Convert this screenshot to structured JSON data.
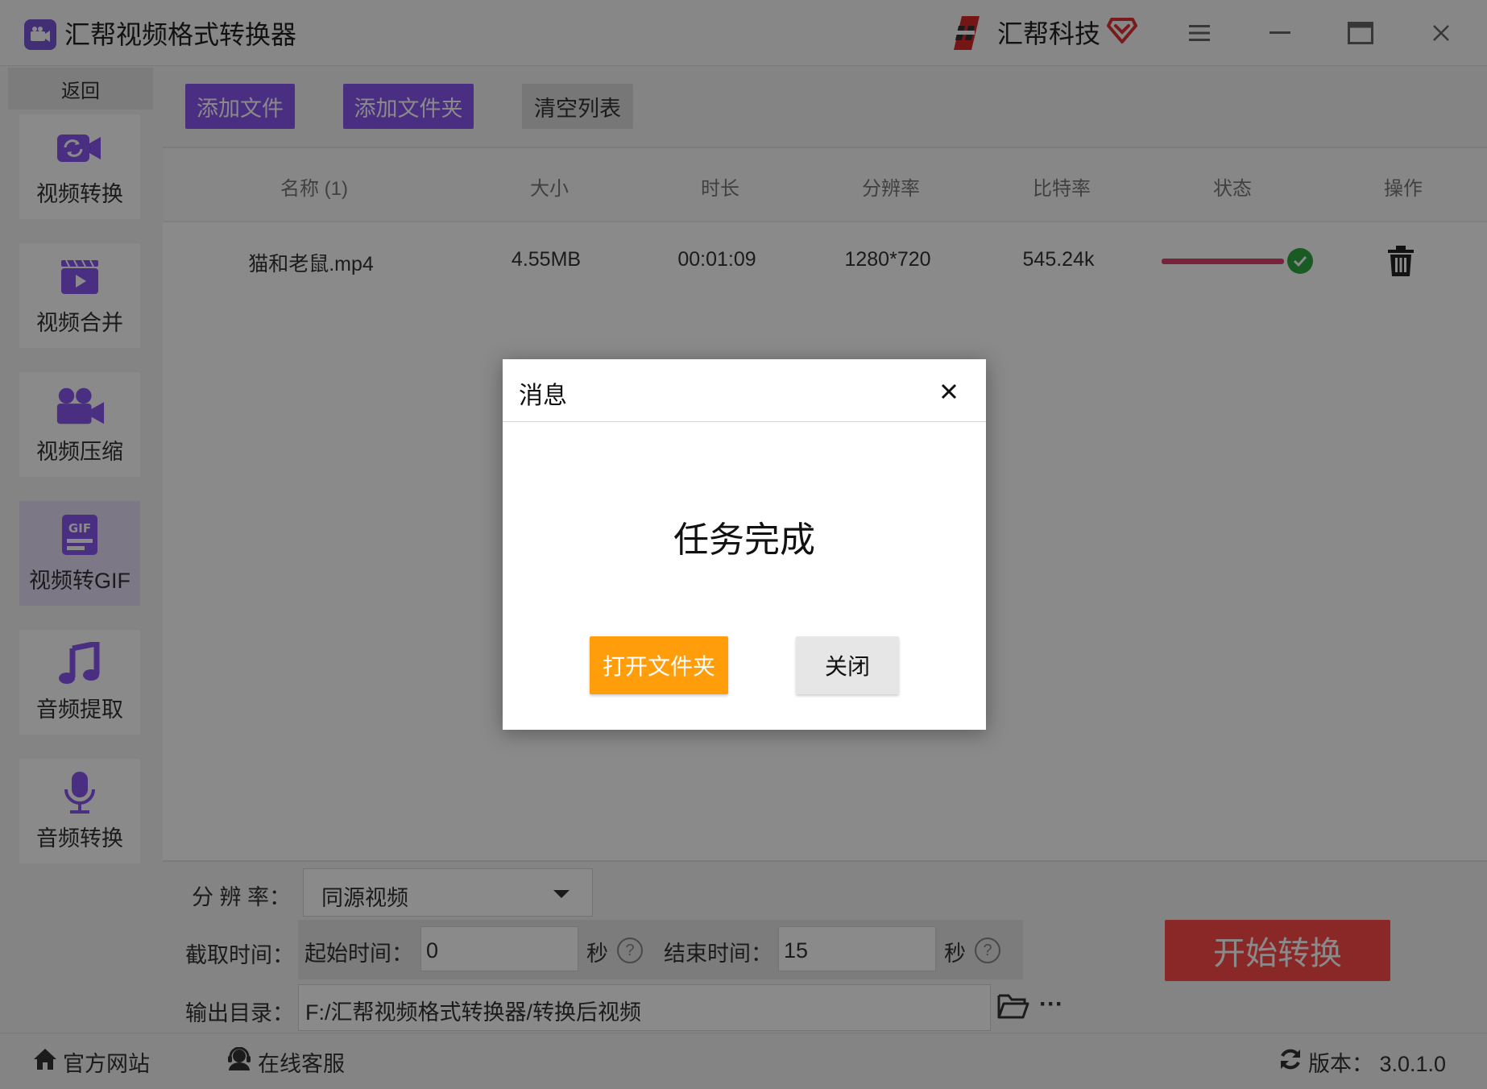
{
  "window": {
    "title": "汇帮视频格式转换器",
    "brand": "汇帮科技"
  },
  "sidebar": {
    "back": "返回",
    "items": [
      {
        "label": "视频转换",
        "icon": "video-convert-icon"
      },
      {
        "label": "视频合并",
        "icon": "video-merge-icon"
      },
      {
        "label": "视频压缩",
        "icon": "video-compress-icon"
      },
      {
        "label": "视频转GIF",
        "icon": "gif-icon",
        "active": true
      },
      {
        "label": "音频提取",
        "icon": "music-note-icon"
      },
      {
        "label": "音频转换",
        "icon": "microphone-icon"
      }
    ]
  },
  "toolbar": {
    "add_file": "添加文件",
    "add_folder": "添加文件夹",
    "clear_list": "清空列表"
  },
  "table": {
    "headers": [
      "名称 (1)",
      "大小",
      "时长",
      "分辨率",
      "比特率",
      "状态",
      "操作"
    ],
    "rows": [
      {
        "name": "猫和老鼠.mp4",
        "size": "4.55MB",
        "duration": "00:01:09",
        "resolution": "1280*720",
        "bitrate": "545.24k",
        "progress": 1.0,
        "status": "done"
      }
    ]
  },
  "settings": {
    "resolution_label": "分 辨 率：",
    "resolution_value": "同源视频",
    "clip_label": "截取时间：",
    "start_label": "起始时间：",
    "start_value": "0",
    "end_label": "结束时间：",
    "end_value": "15",
    "seconds": "秒",
    "help": "?",
    "output_label": "输出目录：",
    "output_path": "F:/汇帮视频格式转换器/转换后视频",
    "more": "···",
    "start_button": "开始转换"
  },
  "statusbar": {
    "website": "官方网站",
    "support": "在线客服",
    "version": "版本：  3.0.1.0"
  },
  "dialog": {
    "title": "消息",
    "message": "任务完成",
    "open_folder": "打开文件夹",
    "close": "关闭"
  },
  "colors": {
    "accent_purple": "#8a55ee",
    "start_red": "#ff4b4b",
    "dialog_orange": "#ff9d0a",
    "progress_pink": "#e04070",
    "success_green": "#2fa83f"
  }
}
